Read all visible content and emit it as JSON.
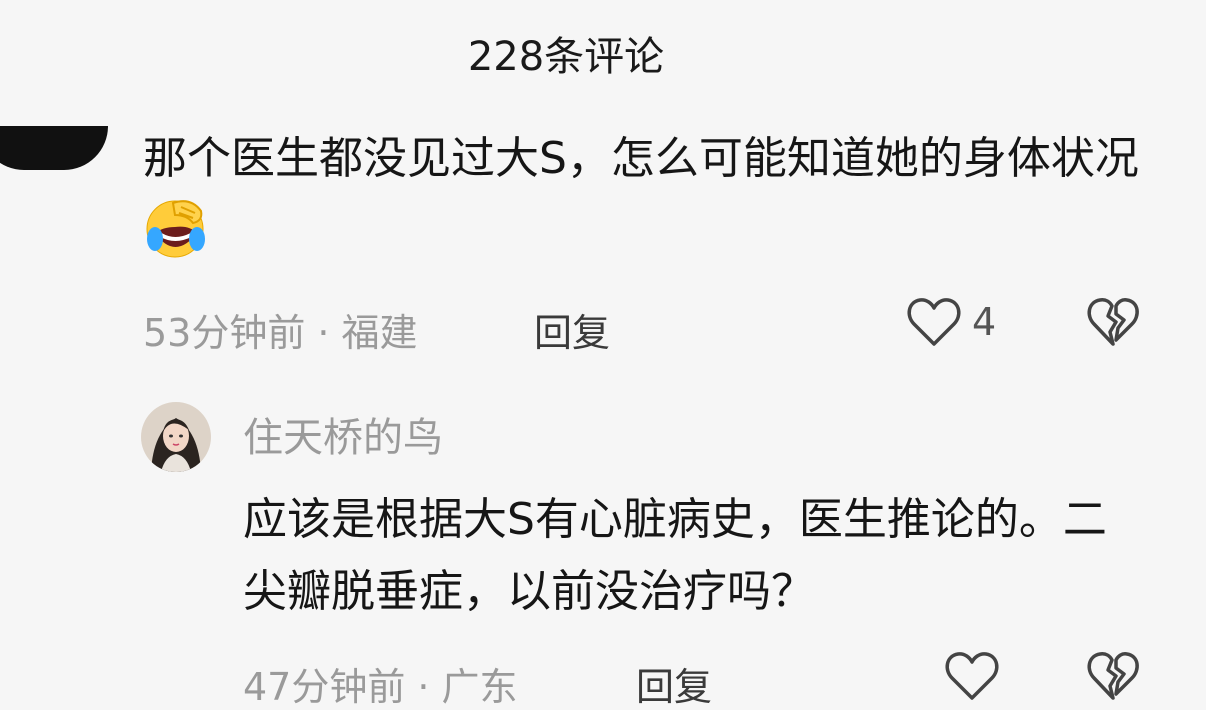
{
  "header": {
    "title": "228条评论"
  },
  "comments": [
    {
      "text": "那个医生都没见过大S，怎么可能知道她的身体状况",
      "emoji": "face-with-tears-of-joy",
      "time": "53分钟前",
      "separator": "·",
      "location": "福建",
      "reply_label": "回复",
      "likes": "4"
    },
    {
      "username": "住天桥的鸟",
      "text": "应该是根据大S有心脏病史，医生推论的。二尖瓣脱垂症，以前没治疗吗？",
      "time": "47分钟前",
      "separator": "·",
      "location": "广东",
      "reply_label": "回复"
    }
  ],
  "colors": {
    "background": "#f6f6f6",
    "text": "#161616",
    "meta": "#9a9a9a"
  }
}
